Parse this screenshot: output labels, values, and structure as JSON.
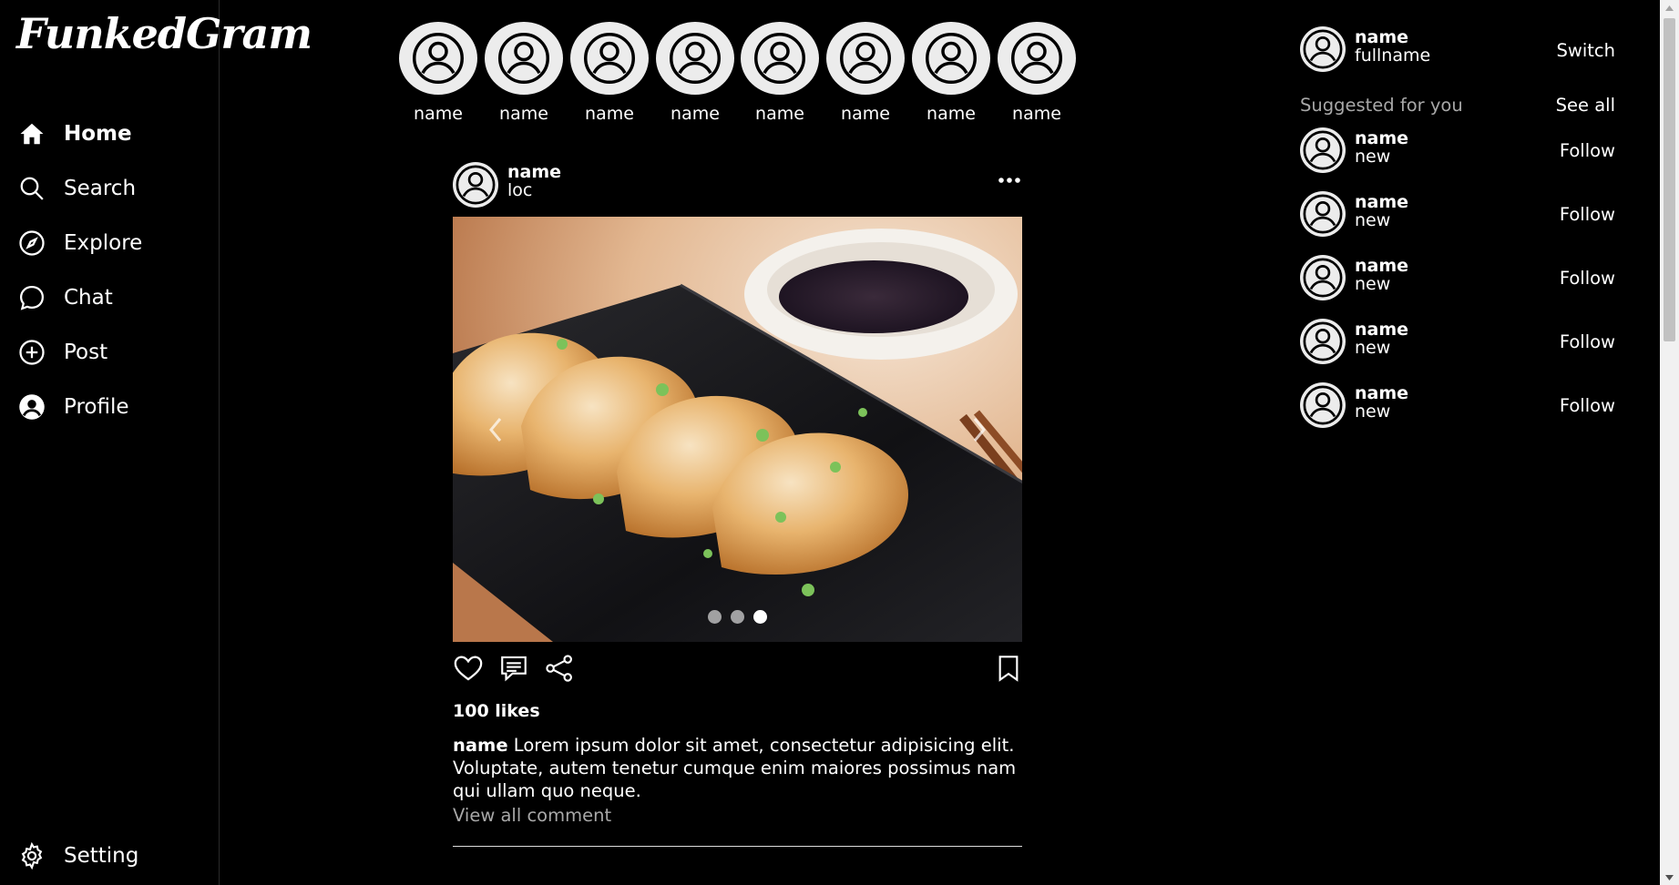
{
  "app": {
    "logo_text": "FunkedGram"
  },
  "sidebar": {
    "items": [
      {
        "label": "Home",
        "icon": "home-icon"
      },
      {
        "label": "Search",
        "icon": "search-icon"
      },
      {
        "label": "Explore",
        "icon": "compass-icon"
      },
      {
        "label": "Chat",
        "icon": "chat-bubble-icon"
      },
      {
        "label": "Post",
        "icon": "plus-circle-icon"
      },
      {
        "label": "Profile",
        "icon": "user-circle-icon"
      }
    ],
    "setting": {
      "label": "Setting",
      "icon": "gear-icon"
    }
  },
  "stories": [
    {
      "name": "name"
    },
    {
      "name": "name"
    },
    {
      "name": "name"
    },
    {
      "name": "name"
    },
    {
      "name": "name"
    },
    {
      "name": "name"
    },
    {
      "name": "name"
    },
    {
      "name": "name"
    }
  ],
  "post": {
    "user": "name",
    "location": "loc",
    "carousel": {
      "total": 3,
      "active": 3
    },
    "likes": "100 likes",
    "caption_user": "name",
    "caption_text": "Lorem ipsum dolor sit amet, consectetur adipisicing elit. Voluptate, autem tenetur cumque enim maiores possimus nam qui ullam quo neque.",
    "view_comments": "View all comment"
  },
  "current_user": {
    "name": "name",
    "fullname": "fullname",
    "switch_label": "Switch"
  },
  "suggestions": {
    "title": "Suggested for you",
    "see_all": "See all",
    "items": [
      {
        "name": "name",
        "sub": "new",
        "action": "Follow"
      },
      {
        "name": "name",
        "sub": "new",
        "action": "Follow"
      },
      {
        "name": "name",
        "sub": "new",
        "action": "Follow"
      },
      {
        "name": "name",
        "sub": "new",
        "action": "Follow"
      },
      {
        "name": "name",
        "sub": "new",
        "action": "Follow"
      }
    ]
  },
  "colors": {
    "background": "#000000",
    "text": "#ffffff",
    "muted": "#a8a8a8",
    "avatar_bg": "#ececec"
  }
}
